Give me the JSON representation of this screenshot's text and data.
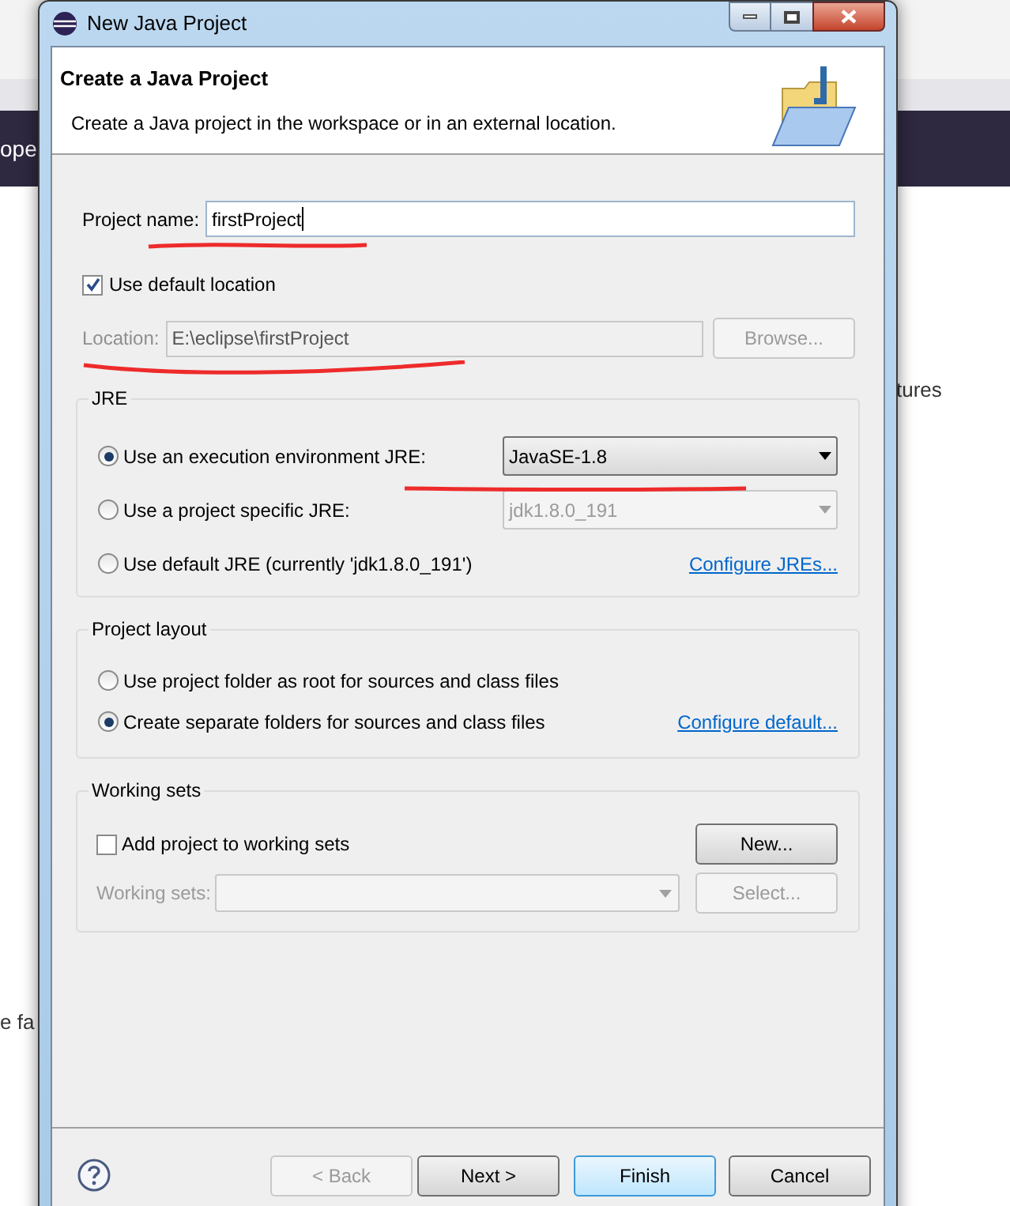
{
  "background_window": {
    "fragments": [
      "ope",
      "tures",
      "e fa"
    ]
  },
  "window": {
    "title": "New Java Project"
  },
  "header": {
    "title": "Create a Java Project",
    "description": "Create a Java project in the workspace or in an external location."
  },
  "project_name": {
    "label": "Project name:",
    "value": "firstProject"
  },
  "default_location": {
    "label": "Use default location",
    "checked": true
  },
  "location": {
    "label": "Location:",
    "value": "E:\\eclipse\\firstProject",
    "disabled": true
  },
  "browse_button": {
    "label": "Browse...",
    "disabled": true
  },
  "jre": {
    "title": "JRE",
    "options": [
      {
        "label": "Use an execution environment JRE:",
        "selected": true,
        "control": {
          "kind": "combo",
          "value": "JavaSE-1.8",
          "disabled": false
        }
      },
      {
        "label": "Use a project specific JRE:",
        "selected": false,
        "control": {
          "kind": "combo",
          "value": "jdk1.8.0_191",
          "disabled": true
        }
      },
      {
        "label": "Use default JRE (currently 'jdk1.8.0_191')",
        "selected": false,
        "control": {
          "kind": "link",
          "text": "Configure JREs..."
        }
      }
    ]
  },
  "project_layout": {
    "title": "Project layout",
    "options": [
      {
        "label": "Use project folder as root for sources and class files",
        "selected": false
      },
      {
        "label": "Create separate folders for sources and class files",
        "selected": true,
        "link": "Configure default..."
      }
    ]
  },
  "working_sets": {
    "title": "Working sets",
    "checkbox": {
      "label": "Add project to working sets",
      "checked": false
    },
    "new_button": {
      "label": "New...",
      "disabled": false
    },
    "field": {
      "label": "Working sets:",
      "disabled": true
    },
    "select_button": {
      "label": "Select...",
      "disabled": true
    }
  },
  "buttons": [
    {
      "label": "< Back",
      "disabled": true,
      "default": false
    },
    {
      "label": "Next >",
      "disabled": false,
      "default": false
    },
    {
      "label": "Finish",
      "disabled": false,
      "default": true
    },
    {
      "label": "Cancel",
      "disabled": false,
      "default": false
    }
  ]
}
